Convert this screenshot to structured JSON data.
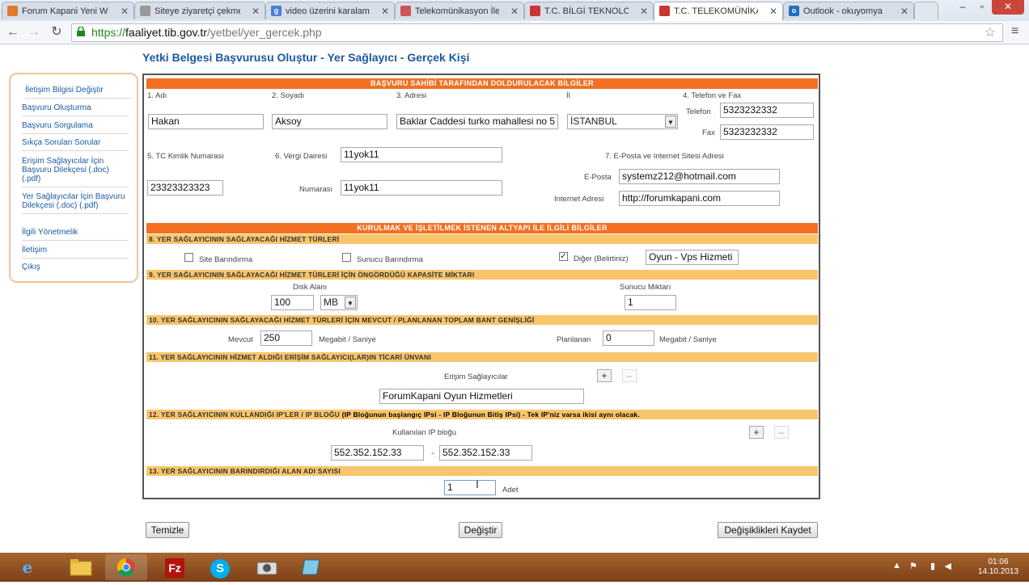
{
  "browser": {
    "tabs": [
      {
        "label": "Forum Kapani Yeni W",
        "icon": "page-icon"
      },
      {
        "label": "Siteye ziyaretçi çekme",
        "icon": "page-icon"
      },
      {
        "label": "video üzerini karalama",
        "icon": "google-icon"
      },
      {
        "label": "Telekomünikasyon İle",
        "icon": "page-icon"
      },
      {
        "label": "T.C. BİLGİ TEKNOLOJİ",
        "icon": "page-icon"
      },
      {
        "label": "T.C. TELEKOMÜNİKAS",
        "icon": "page-icon"
      },
      {
        "label": "Outlook - okuyomya",
        "icon": "outlook-icon"
      }
    ],
    "url": {
      "https": "https://",
      "host": "faaliyet.tib.gov.tr",
      "path": "/yetbel/yer_gercek.php"
    }
  },
  "page": {
    "title": "Yetki Belgesi Başvurusu Oluştur - Yer Sağlayıcı - Gerçek Kişi"
  },
  "sidebar": {
    "items": [
      "İletişim Bilgisi Değiştir",
      "Başvuru Oluşturma",
      "Başvuru Sorgulama",
      "Sıkça Sorulan Sorular",
      "Erişim Sağlayıcılar İçin Başvuru Dilekçesi (.doc) (.pdf)",
      "Yer Sağlayıcılar İçin Başvuru Dilekçesi (.doc) (.pdf)",
      "İlgili Yönetmelik",
      "İletişim",
      "Çıkış"
    ]
  },
  "form": {
    "section1_header": "BAŞVURU SAHİBİ TARAFINDAN DOLDURULACAK BİLGİLER",
    "labels": {
      "adi": "1. Adı",
      "soyadi": "2. Soyadı",
      "adresi": "3. Adresi",
      "il": "İl",
      "telefon_fax": "4. Telefon ve Fax",
      "telefon": "Telefon",
      "fax": "Fax",
      "tc": "5. TC Kimlik Numarası",
      "vergi": "6. Vergi Dairesi",
      "numarasi": "Numarası",
      "eposta_site": "7. E-Posta ve Internet Sitesi Adresi",
      "eposta": "E-Posta",
      "internet": "Internet Adresi"
    },
    "values": {
      "adi": "Hakan",
      "soyadi": "Aksoy",
      "adresi": "Baklar Caddesi turko mahallesi no 5",
      "il": "İSTANBUL",
      "telefon": "5323232332",
      "fax": "5323232332",
      "tc": "23323323323",
      "vergi": "11yok11",
      "numarasi": "11yok11",
      "eposta": "systemz212@hotmail.com",
      "internet": "http://forumkapani.com"
    },
    "section2_header": "KURULMAK VE İŞLETİLMEK İSTENEN ALTYAPI İLE İLGİLİ BİLGİLER",
    "s8": {
      "header": "8. YER SAĞLAYICININ SAĞLAYACAĞI HİZMET TÜRLERİ",
      "site": "Site Barındırma",
      "sunucu": "Sunucu Barındırma",
      "diger": "Diğer (Belirtiniz)",
      "diger_value": "Oyun - Vps Hizmeti",
      "site_checked": false,
      "sunucu_checked": false,
      "diger_checked": true
    },
    "s9": {
      "header": "9. YER SAĞLAYICININ SAĞLAYACAĞI HİZMET TÜRLERİ İÇİN ÖNGÖRDÜĞÜ KAPASİTE MİKTARI",
      "disk_label": "Disk Alanı",
      "disk_value": "100",
      "disk_unit": "MB",
      "sunucu_label": "Sunucu Miktarı",
      "sunucu_value": "1"
    },
    "s10": {
      "header": "10. YER SAĞLAYICININ SAĞLAYACAĞI HİZMET TÜRLERİ İÇİN MEVCUT / PLANLANAN TOPLAM BANT GENİŞLİĞİ",
      "mevcut_label": "Mevcut",
      "mevcut_value": "250",
      "unit": "Megabit / Saniye",
      "planlanan_label": "Planlanan",
      "planlanan_value": "0"
    },
    "s11": {
      "header": "11. YER SAĞLAYICININ HİZMET ALDIĞI ERİŞİM SAĞLAYICI(LAR)IN TİCARİ ÜNVANI",
      "label": "Erişim Sağlayıcılar",
      "value": "ForumKapani Oyun Hizmetleri"
    },
    "s12": {
      "header": "12. YER SAĞLAYICININ KULLANDIĞI IP'LER / IP BLOĞU",
      "header_note": "(IP Bloğunun başlangıç IPsi - IP Bloğunun Bitiş IPsi) - Tek IP'niz varsa ikisi aynı olacak.",
      "label": "Kullanılan IP bloğu",
      "ip_start": "552.352.152.33",
      "ip_end": "552.352.152.33",
      "dash": "-"
    },
    "s13": {
      "header": "13. YER SAĞLAYICININ BARINDIRDIĞI ALAN ADI SAYISI",
      "value": "1",
      "unit": "Adet"
    },
    "plus": "+",
    "minus": "–"
  },
  "buttons": {
    "temizle": "Temizle",
    "degistir": "Değiştir",
    "kaydet": "Değişiklikleri Kaydet"
  },
  "taskbar": {
    "time": "01:06",
    "date": "14.10.2013"
  }
}
